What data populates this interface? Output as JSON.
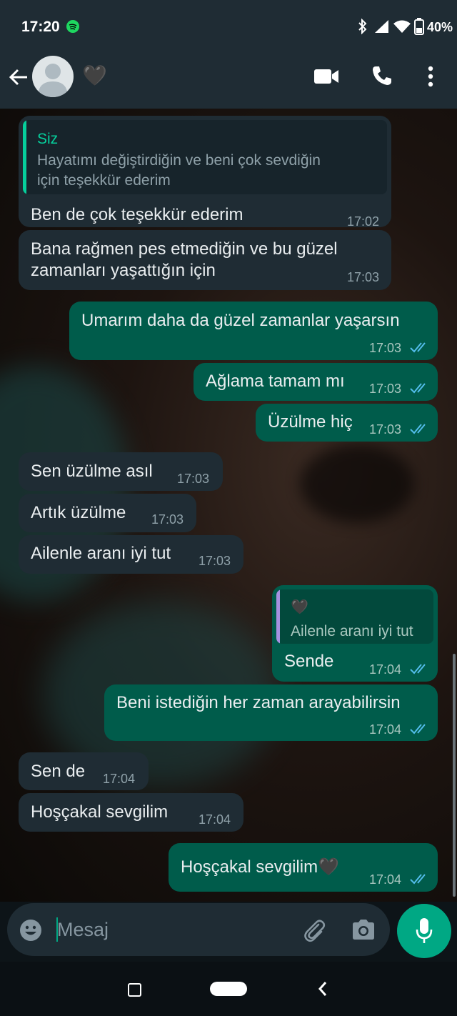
{
  "status_bar": {
    "time": "17:20",
    "battery": "40%",
    "icons": [
      "spotify-icon",
      "bluetooth-icon",
      "signal-icon",
      "wifi-icon",
      "battery-icon"
    ]
  },
  "header": {
    "contact_name": "🖤",
    "icons": [
      "back-arrow-icon",
      "avatar",
      "video-call-icon",
      "voice-call-icon",
      "more-options-icon"
    ]
  },
  "messages": [
    {
      "dir": "in",
      "quote_author": "Siz",
      "quote_line1": "Hayatımı değiştirdiğin ve beni çok sevdiğin",
      "quote_line2": "için teşekkür ederim",
      "text": "Ben de çok teşekkür ederim",
      "time": "17:02"
    },
    {
      "dir": "in",
      "text_line1": "Bana rağmen pes etmediğin ve bu güzel",
      "text_line2": "zamanları yaşattığın için",
      "time": "17:03"
    },
    {
      "dir": "out",
      "text": "Umarım daha da güzel zamanlar yaşarsın",
      "time": "17:03"
    },
    {
      "dir": "out",
      "text": "Ağlama tamam mı",
      "time": "17:03"
    },
    {
      "dir": "out",
      "text": "Üzülme hiç",
      "time": "17:03"
    },
    {
      "dir": "in",
      "text": "Sen üzülme asıl",
      "time": "17:03"
    },
    {
      "dir": "in",
      "text": "Artık üzülme",
      "time": "17:03"
    },
    {
      "dir": "in",
      "text": "Ailenle aranı iyi tut",
      "time": "17:03"
    },
    {
      "dir": "out",
      "quote_author": "🖤",
      "quote_line1": "Ailenle aranı iyi tut",
      "text": "Sende",
      "time": "17:04"
    },
    {
      "dir": "out",
      "text": "Beni istediğin her zaman arayabilirsin",
      "time": "17:04"
    },
    {
      "dir": "in",
      "text": "Sen de",
      "time": "17:04"
    },
    {
      "dir": "in",
      "text": "Hoşçakal sevgilim",
      "time": "17:04"
    },
    {
      "dir": "out",
      "text": "Hoşçakal sevgilim🖤",
      "time": "17:04"
    }
  ],
  "input": {
    "placeholder": "Mesaj"
  },
  "colors": {
    "header_bg": "#1f2c34",
    "incoming_bubble": "#1f2c34",
    "outgoing_bubble": "#005c4b",
    "accent": "#00a884",
    "read_ticks": "#53bdeb"
  }
}
